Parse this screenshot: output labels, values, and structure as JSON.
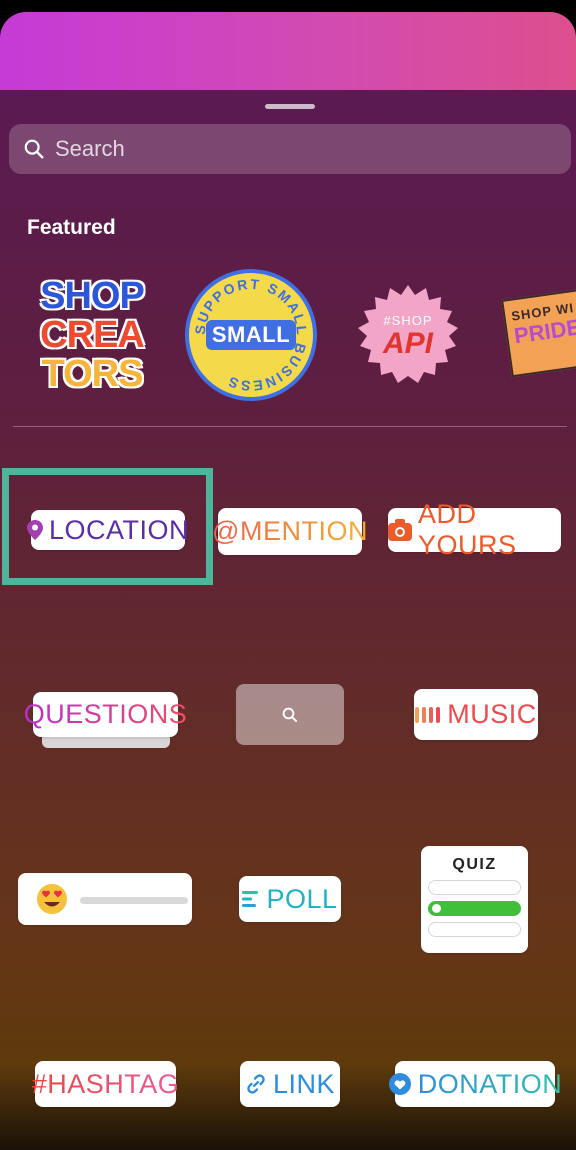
{
  "search": {
    "placeholder": "Search"
  },
  "featured": {
    "label": "Featured",
    "stickers": [
      {
        "name": "shop-creators",
        "lines": [
          "SHOP",
          "CREA",
          "TORS"
        ]
      },
      {
        "name": "support-small-business",
        "ring": "SUPPORT SMALL BUSINESS",
        "center": "SMALL"
      },
      {
        "name": "shop-api",
        "top": "#SHOP",
        "main": "API"
      },
      {
        "name": "shop-pride",
        "top": "SHOP WI",
        "main": "PRIDE"
      }
    ]
  },
  "stickers": {
    "location": "LOCATION",
    "mention": "@MENTION",
    "add_yours": "ADD YOURS",
    "questions": "QUESTIONS",
    "music": "MUSIC",
    "poll": "POLL",
    "quiz": "QUIZ",
    "hashtag": "#HASHTAG",
    "link": "LINK",
    "donation": "DONATION"
  },
  "colors": {
    "highlight": "#4cb59c",
    "location": "#5b2ea6",
    "add_yours": "#ee5b2a",
    "music": "#ee4a4f",
    "poll": "#1fb3c4",
    "link": "#2a8fe2"
  }
}
